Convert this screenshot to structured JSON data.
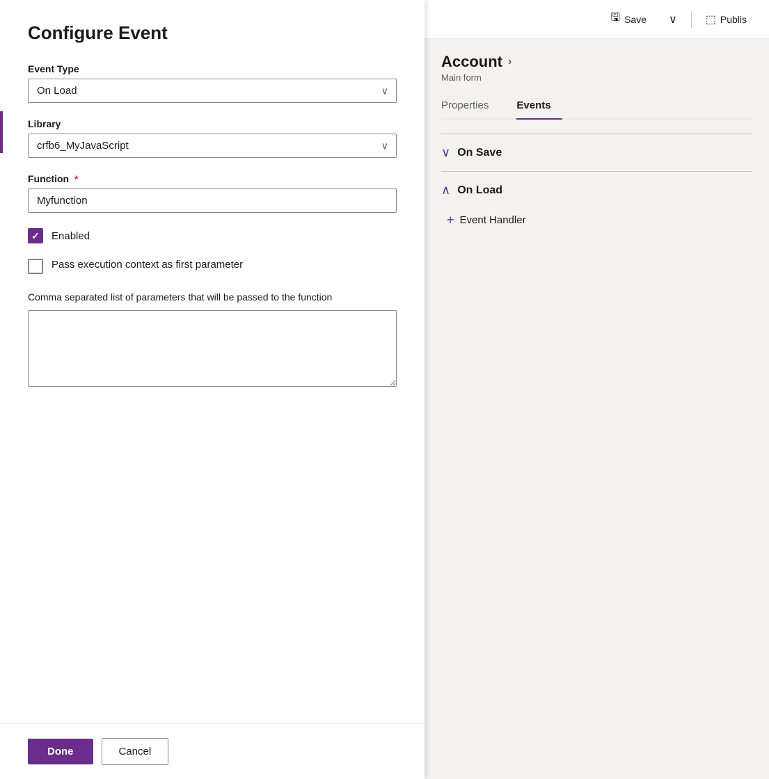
{
  "dialog": {
    "title": "Configure Event",
    "event_type_label": "Event Type",
    "event_type_value": "On Load",
    "library_label": "Library",
    "library_value": "crfb6_MyJavaScript",
    "function_label": "Function",
    "function_required": true,
    "function_value": "Myfunction",
    "enabled_label": "Enabled",
    "enabled_checked": true,
    "pass_context_label": "Pass execution context as first parameter",
    "pass_context_checked": false,
    "params_label": "Comma separated list of parameters that will be passed to the function",
    "params_value": "",
    "done_label": "Done",
    "cancel_label": "Cancel"
  },
  "topbar": {
    "save_label": "Save",
    "publish_label": "Publis",
    "save_icon": "💾",
    "chevron_icon": "∨",
    "publish_icon": "📤"
  },
  "right": {
    "entity_title": "Account",
    "entity_subtitle": "Main form",
    "chevron": "›",
    "tab_properties": "Properties",
    "tab_events": "Events",
    "active_tab": "Events",
    "on_save_label": "On Save",
    "on_load_label": "On Load",
    "add_handler_label": "Event Handler"
  }
}
